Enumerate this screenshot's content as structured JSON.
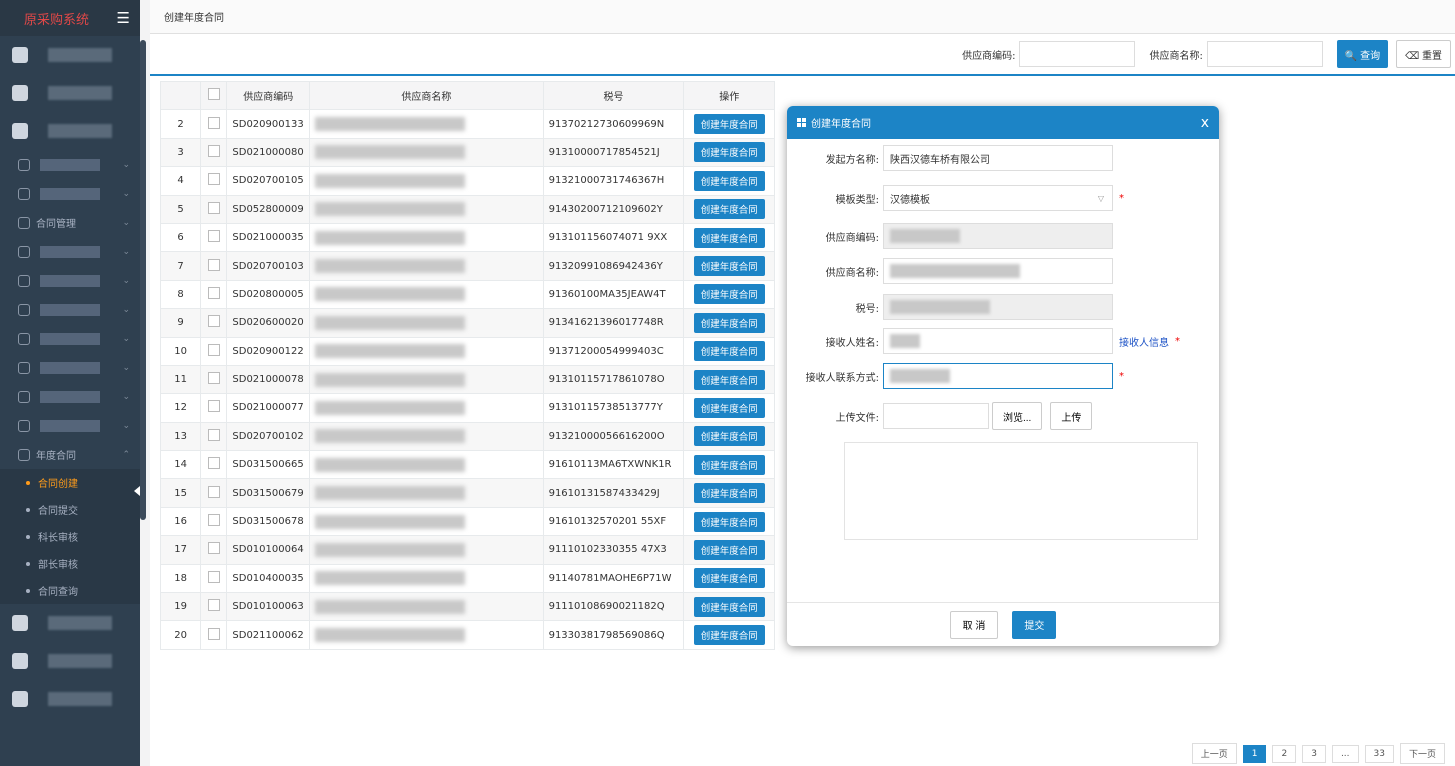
{
  "app": {
    "title": "原采购系统",
    "menu_icon": "hamburger-icon"
  },
  "sidebar": {
    "contract_mgmt": "合同管理",
    "annual_contract": "年度合同",
    "subitems": [
      "合同创建",
      "合同提交",
      "科长审核",
      "部长审核",
      "合同查询"
    ]
  },
  "tab": {
    "label": "创建年度合同"
  },
  "search": {
    "supplier_code_label": "供应商编码:",
    "supplier_name_label": "供应商名称:",
    "query_button": "查询",
    "reset_button": "重置"
  },
  "table": {
    "headers": [
      "供应商编码",
      "供应商名称",
      "税号",
      "操作"
    ],
    "op_label": "创建年度合同",
    "rows": [
      {
        "n": "2",
        "code": "SD020900133",
        "tax": "91370212730609969N"
      },
      {
        "n": "3",
        "code": "SD021000080",
        "tax": "91310000717854521J"
      },
      {
        "n": "4",
        "code": "SD020700105",
        "tax": "91321000731746367H"
      },
      {
        "n": "5",
        "code": "SD052800009",
        "tax": "91430200712109602Y"
      },
      {
        "n": "6",
        "code": "SD021000035",
        "tax": "913101156074071 9XX"
      },
      {
        "n": "7",
        "code": "SD020700103",
        "tax": "91320991086942436Y"
      },
      {
        "n": "8",
        "code": "SD020800005",
        "tax": "91360100MA35JEAW4T"
      },
      {
        "n": "9",
        "code": "SD020600020",
        "tax": "91341621396017748R"
      },
      {
        "n": "10",
        "code": "SD020900122",
        "tax": "91371200054999403C"
      },
      {
        "n": "11",
        "code": "SD021000078",
        "tax": "91310115717861078O"
      },
      {
        "n": "12",
        "code": "SD021000077",
        "tax": "91310115738513777Y"
      },
      {
        "n": "13",
        "code": "SD020700102",
        "tax": "91321000056616200O"
      },
      {
        "n": "14",
        "code": "SD031500665",
        "tax": "91610113MA6TXWNK1R"
      },
      {
        "n": "15",
        "code": "SD031500679",
        "tax": "91610131587433429J"
      },
      {
        "n": "16",
        "code": "SD031500678",
        "tax": "91610132570201 55XF"
      },
      {
        "n": "17",
        "code": "SD010100064",
        "tax": "91110102330355 47X3"
      },
      {
        "n": "18",
        "code": "SD010400035",
        "tax": "91140781MAOHE6P71W"
      },
      {
        "n": "19",
        "code": "SD010100063",
        "tax": "91110108690021182Q"
      },
      {
        "n": "20",
        "code": "SD021100062",
        "tax": "91330381798569086Q"
      }
    ]
  },
  "pager": {
    "prev": "上一页",
    "pages": [
      "1",
      "2",
      "3",
      "...",
      "33"
    ],
    "next": "下一页"
  },
  "modal": {
    "title": "创建年度合同",
    "close": "x",
    "initiator_label": "发起方名称:",
    "initiator_value": "陕西汉德车桥有限公司",
    "template_label": "模板类型:",
    "template_value": "汉德模板",
    "supplier_code_label": "供应商编码:",
    "supplier_name_label": "供应商名称:",
    "tax_label": "税号:",
    "receiver_name_label": "接收人姓名:",
    "receiver_info_link": "接收人信息",
    "receiver_contact_label": "接收人联系方式:",
    "upload_label": "上传文件:",
    "browse_button": "浏览...",
    "upload_button": "上传",
    "cancel_button": "取 消",
    "submit_button": "提交"
  },
  "colors": {
    "sidebar": "#2f4050",
    "accent": "#1c84c6",
    "active_menu": "#ff9c1a"
  }
}
